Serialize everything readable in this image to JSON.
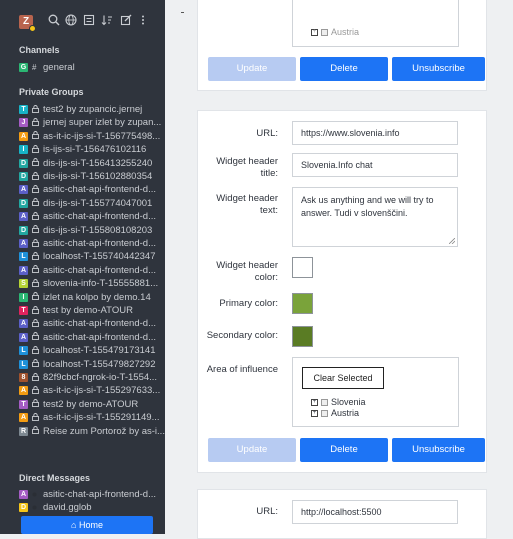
{
  "sidebar": {
    "user_initial": "Z",
    "sections": {
      "channels": "Channels",
      "private_groups": "Private Groups",
      "direct_messages": "Direct Messages"
    },
    "channels": [
      {
        "initial": "G",
        "color": "#2bb673",
        "label": "general"
      }
    ],
    "groups": [
      {
        "initial": "T",
        "color": "#17b3c6",
        "label": "test2 by zupancic.jernej"
      },
      {
        "initial": "J",
        "color": "#a45cc4",
        "label": "jernej super izlet by zupan..."
      },
      {
        "initial": "A",
        "color": "#f39c12",
        "label": "as-it-ic-ijs-si-T-156775498..."
      },
      {
        "initial": "I",
        "color": "#17b3c6",
        "label": "is-ijs-si-T-156476102116"
      },
      {
        "initial": "D",
        "color": "#22a7a0",
        "label": "dis-ijs-si-T-156413255240"
      },
      {
        "initial": "D",
        "color": "#22a7a0",
        "label": "dis-ijs-si-T-156102880354"
      },
      {
        "initial": "A",
        "color": "#5b5fc7",
        "label": "asitic-chat-api-frontend-d..."
      },
      {
        "initial": "D",
        "color": "#22a7a0",
        "label": "dis-ijs-si-T-155774047001"
      },
      {
        "initial": "A",
        "color": "#5b5fc7",
        "label": "asitic-chat-api-frontend-d..."
      },
      {
        "initial": "D",
        "color": "#22a7a0",
        "label": "dis-ijs-si-T-155808108203"
      },
      {
        "initial": "A",
        "color": "#5b5fc7",
        "label": "asitic-chat-api-frontend-d..."
      },
      {
        "initial": "L",
        "color": "#1e90d8",
        "label": "localhost-T-155740442347"
      },
      {
        "initial": "A",
        "color": "#5b5fc7",
        "label": "asitic-chat-api-frontend-d..."
      },
      {
        "initial": "S",
        "color": "#b5d334",
        "label": "slovenia-info-T-15555881..."
      },
      {
        "initial": "I",
        "color": "#2bb673",
        "label": "izlet na kolpo by demo.14"
      },
      {
        "initial": "T",
        "color": "#e0245e",
        "label": "test by demo-ATOUR"
      },
      {
        "initial": "A",
        "color": "#5b5fc7",
        "label": "asitic-chat-api-frontend-d..."
      },
      {
        "initial": "A",
        "color": "#5b5fc7",
        "label": "asitic-chat-api-frontend-d..."
      },
      {
        "initial": "L",
        "color": "#1e90d8",
        "label": "localhost-T-155479173141"
      },
      {
        "initial": "L",
        "color": "#1e90d8",
        "label": "localhost-T-155479827292"
      },
      {
        "initial": "8",
        "color": "#a0522d",
        "label": "82f9cbcf-ngrok-io-T-1554..."
      },
      {
        "initial": "A",
        "color": "#f39c12",
        "label": "as-it-ic-ijs-si-T-155297633..."
      },
      {
        "initial": "T",
        "color": "#a45cc4",
        "label": "test2 by demo-ATOUR"
      },
      {
        "initial": "A",
        "color": "#f39c12",
        "label": "as-it-ic-ijs-si-T-155291149..."
      },
      {
        "initial": "R",
        "color": "#7d8891",
        "label": "Reise zum Portorož by as-i..."
      }
    ],
    "dms": [
      {
        "initial": "A",
        "color": "#a45cc4",
        "label": "asitic-chat-api-frontend-d..."
      },
      {
        "initial": "D",
        "color": "#f5c518",
        "label": "david.gglob"
      }
    ],
    "home_label": "Home"
  },
  "card1": {
    "partial_option": "Austria",
    "update_label": "Update",
    "delete_label": "Delete",
    "unsubscribe_label": "Unsubscribe"
  },
  "card2": {
    "url_label": "URL:",
    "url_value": "https://www.slovenia.info",
    "title_label_1": "Widget header",
    "title_label_2": "title:",
    "title_value": "Slovenia.Info chat",
    "text_label_1": "Widget header",
    "text_label_2": "text:",
    "text_value": "Ask us anything and we will try to answer. Tudi v slovenščini.",
    "color_label_1": "Widget header",
    "color_label_2": "color:",
    "header_color": "#ffffff",
    "primary_label": "Primary color:",
    "primary_color": "#7aa33a",
    "secondary_label": "Secondary color:",
    "secondary_color": "#5a7c24",
    "area_label": "Area of influence",
    "clear_label": "Clear Selected",
    "area_options": [
      "Slovenia",
      "Austria"
    ],
    "update_label": "Update",
    "delete_label": "Delete",
    "unsubscribe_label": "Unsubscribe"
  },
  "card3": {
    "url_label": "URL:",
    "url_value": "http://localhost:5500"
  },
  "colors": {
    "sidebar_bg": "#2f343d",
    "accent": "#1d74f5",
    "disabled_button": "#b7cbf2"
  }
}
